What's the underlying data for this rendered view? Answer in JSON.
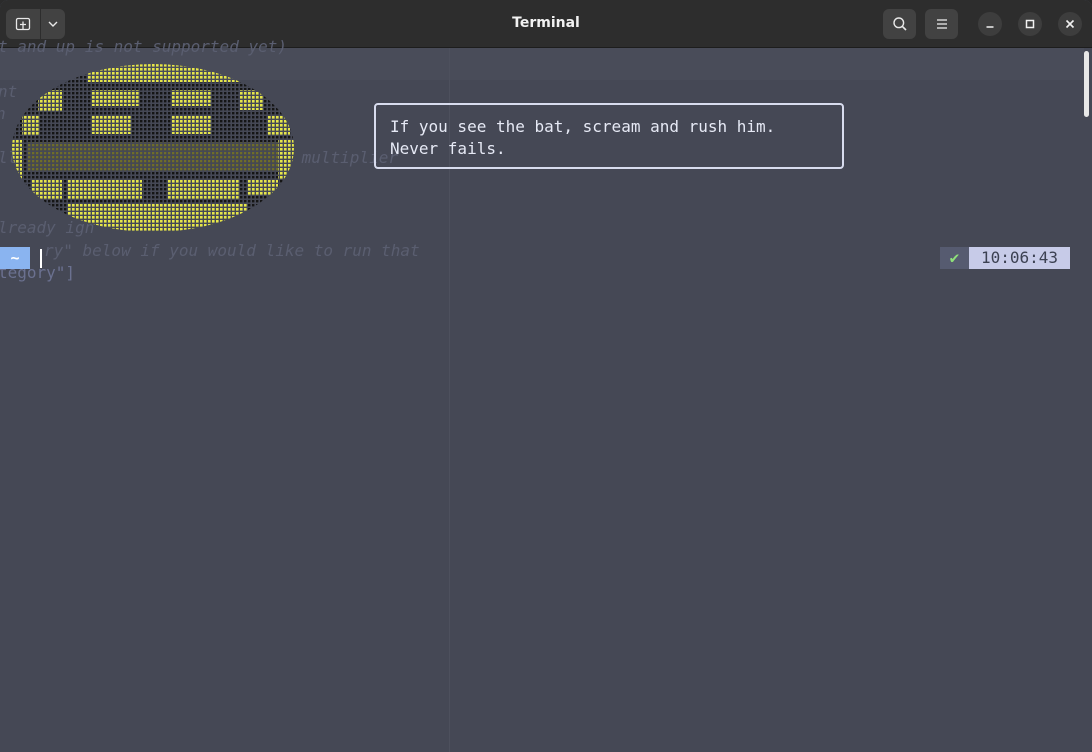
{
  "window": {
    "title": "Terminal"
  },
  "header": {
    "new_tab_icon": "new-tab-icon",
    "dropdown_icon": "chevron-down-icon",
    "search_icon": "search-icon",
    "menu_icon": "hamburger-menu-icon",
    "minimize_icon": "minimize-icon",
    "maximize_icon": "maximize-icon",
    "close_icon": "close-icon"
  },
  "terminal": {
    "background_lines": [
      "t and up is not supported yet)",
      "nt",
      "n",
      "ll",
      " multiplier",
      "lready ign",
      "ry\" below if you would like to run that",
      "tegory\"]"
    ],
    "fortune": {
      "line1": "If you see the bat, scream and rush him.",
      "line2": "Never fails."
    },
    "prompt": {
      "directory": "~",
      "status_symbol": "✔",
      "time": "10:06:43"
    }
  },
  "colors": {
    "terminal_bg": "#454855",
    "headerbar_bg": "#2d2d2d",
    "bat_yellow": "#e8e84a",
    "bat_dark": "#1a1a1a",
    "prompt_blue": "#8ab4f0",
    "time_bg": "#c7cbe8",
    "check_green": "#8ee07a"
  }
}
